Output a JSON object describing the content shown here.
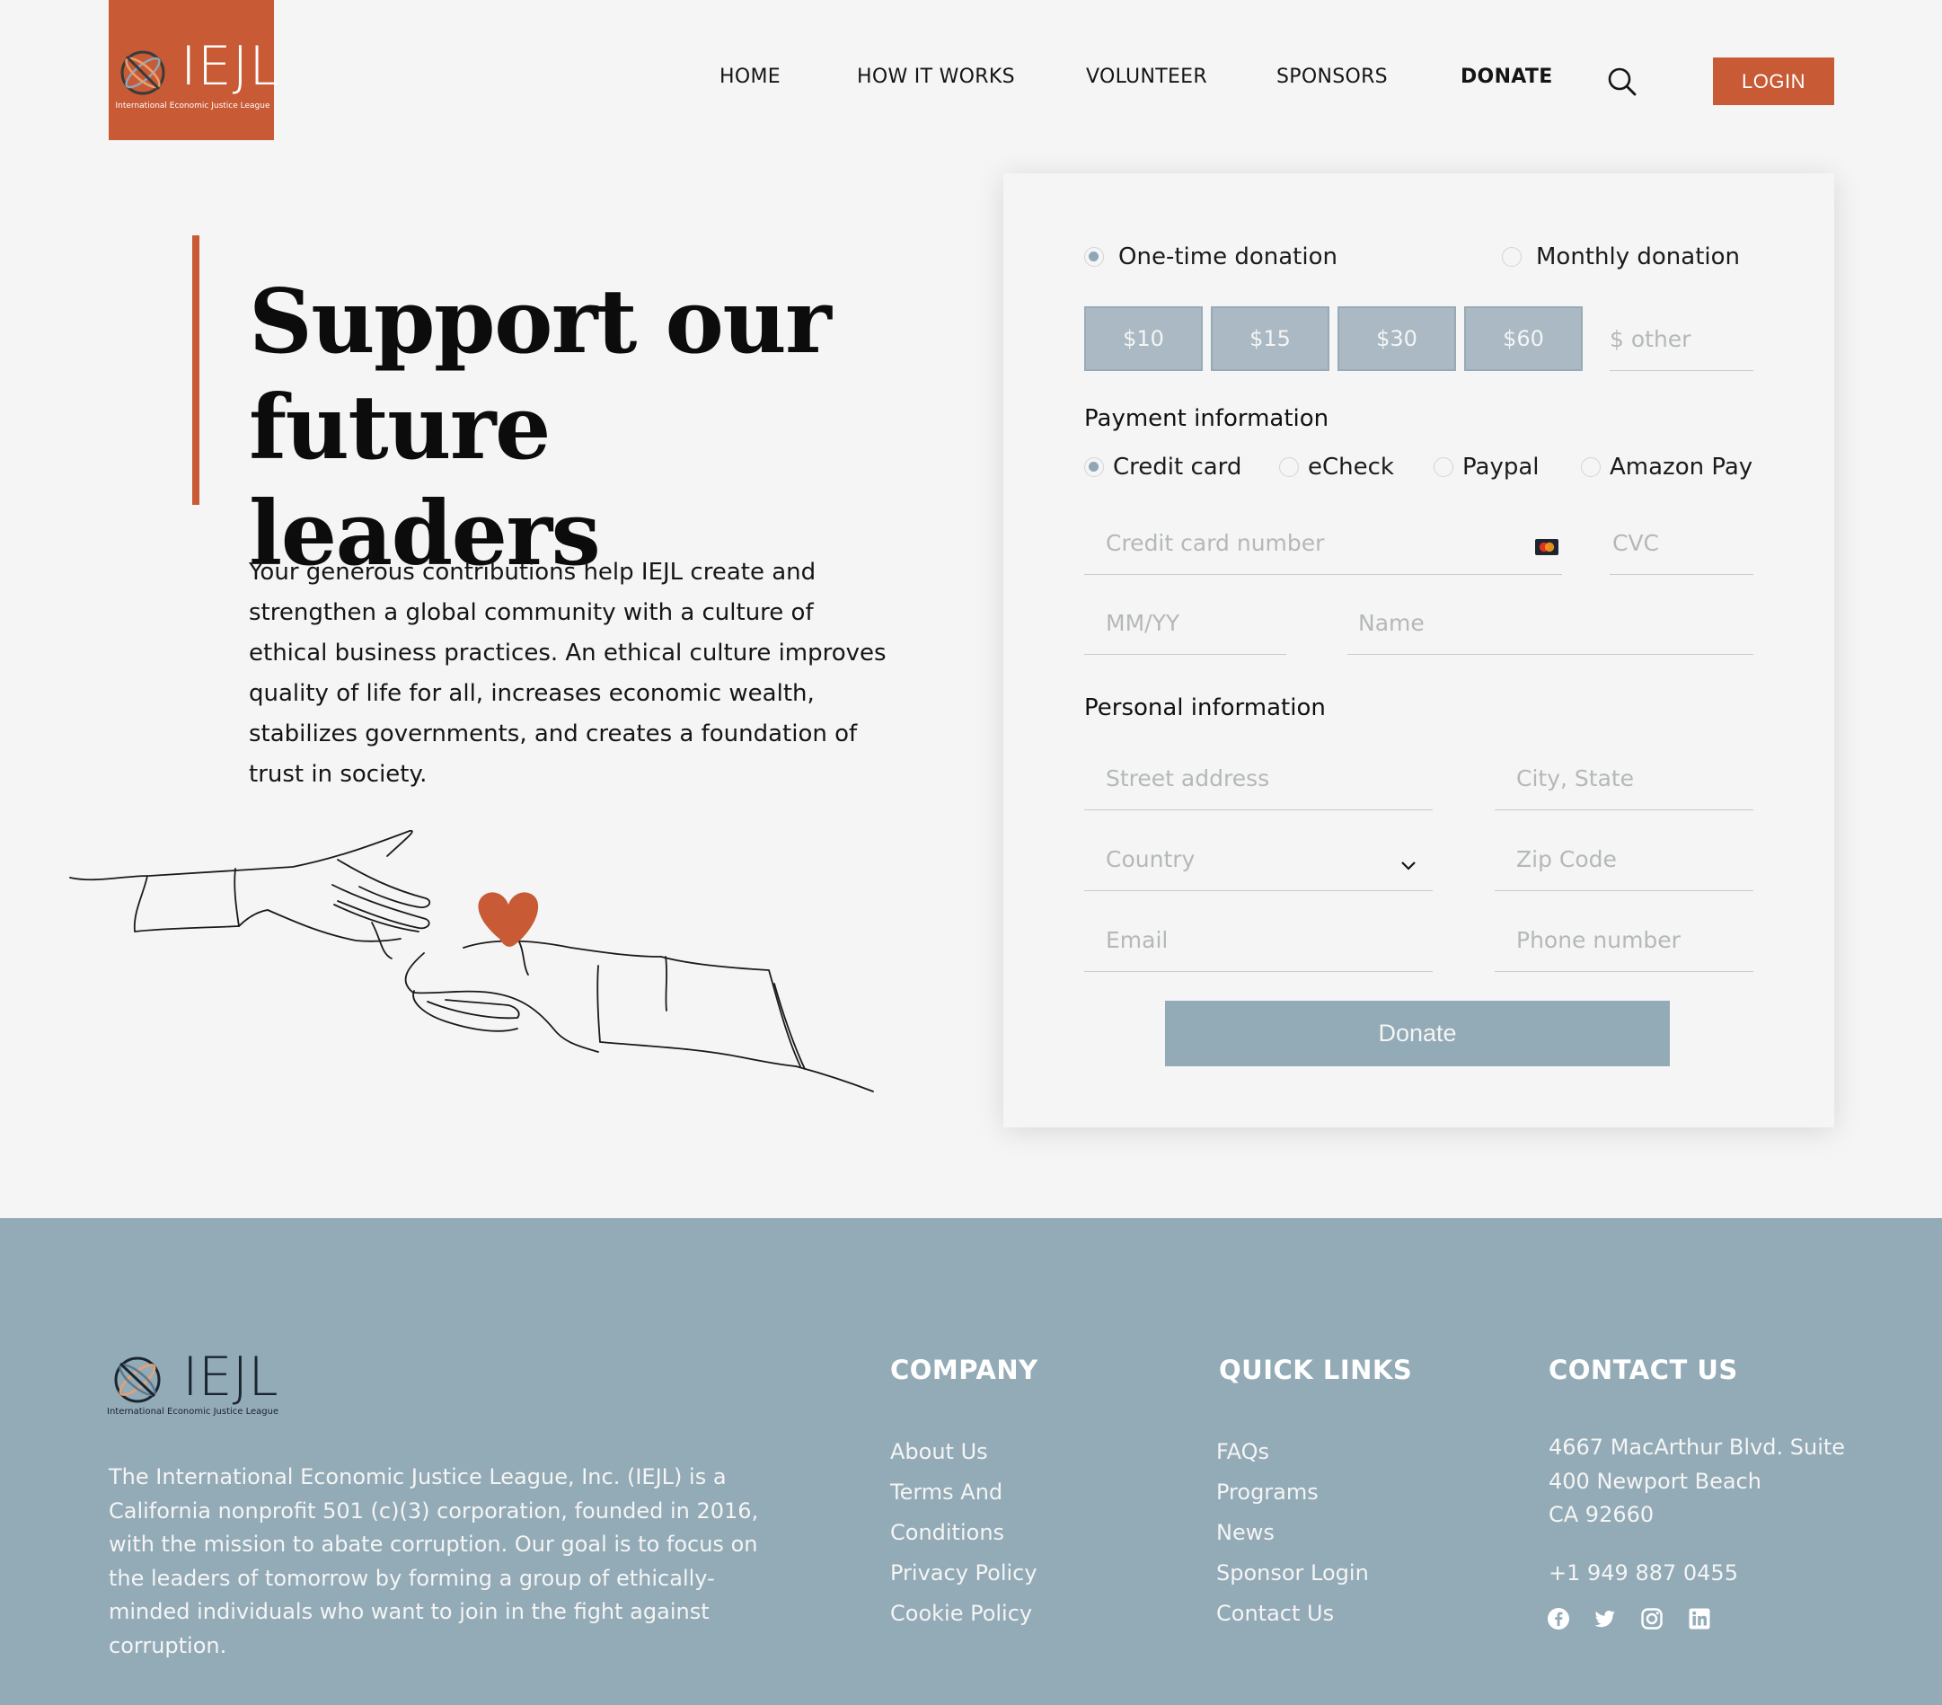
{
  "brand": {
    "name": "IEJL",
    "tagline": "International Economic Justice League",
    "color_accent": "#c85a35",
    "color_slate": "#93aab7"
  },
  "nav": {
    "items": [
      "HOME",
      "HOW IT WORKS",
      "VOLUNTEER",
      "SPONSORS",
      "DONATE"
    ],
    "active": "DONATE",
    "login_label": "LOGIN"
  },
  "hero": {
    "title_line1": "Support our",
    "title_line2": "future leaders",
    "body": "Your generous contributions help IEJL create and strengthen a global community with a culture of ethical business practices. An ethical culture improves quality of life for all, increases economic wealth, stabilizes governments, and creates a foundation of trust in society."
  },
  "donation": {
    "frequency": {
      "one_time": "One-time donation",
      "monthly": "Monthly donation",
      "selected": "one_time"
    },
    "amounts": [
      "$10",
      "$15",
      "$30",
      "$60"
    ],
    "other_placeholder": "$ other",
    "payment_heading": "Payment information",
    "payment_methods": [
      "Credit card",
      "eCheck",
      "Paypal",
      "Amazon Pay"
    ],
    "payment_selected": "Credit card",
    "card_number_placeholder": "Credit card number",
    "cvc_placeholder": "CVC",
    "expiry_placeholder": "MM/YY",
    "name_placeholder": "Name",
    "personal_heading": "Personal information",
    "street_placeholder": "Street address",
    "city_placeholder": "City, State",
    "country_placeholder": "Country",
    "zip_placeholder": "Zip Code",
    "email_placeholder": "Email",
    "phone_placeholder": "Phone number",
    "submit_label": "Donate"
  },
  "footer": {
    "about": "The International Economic Justice League, Inc. (IEJL) is a California nonprofit 501 (c)(3) corporation, founded in 2016, with the mission to abate corruption. Our goal is to focus on the leaders of tomorrow by forming a group of ethically-minded individuals who want to join in the fight against corruption.",
    "company_heading": "COMPANY",
    "company_links": [
      "About Us",
      "Terms And",
      "Conditions",
      "Privacy Policy",
      "Cookie Policy"
    ],
    "quick_heading": "QUICK LINKS",
    "quick_links": [
      "FAQs",
      "Programs",
      "News",
      "Sponsor Login",
      "Contact Us"
    ],
    "contact_heading": "CONTACT US",
    "address_line1": "4667 MacArthur Blvd. Suite",
    "address_line2": "400 Newport Beach",
    "address_line3": "CA 92660",
    "phone": "+1 949 887 0455",
    "social_icons": [
      "facebook-icon",
      "twitter-icon",
      "instagram-icon",
      "linkedin-icon"
    ]
  }
}
